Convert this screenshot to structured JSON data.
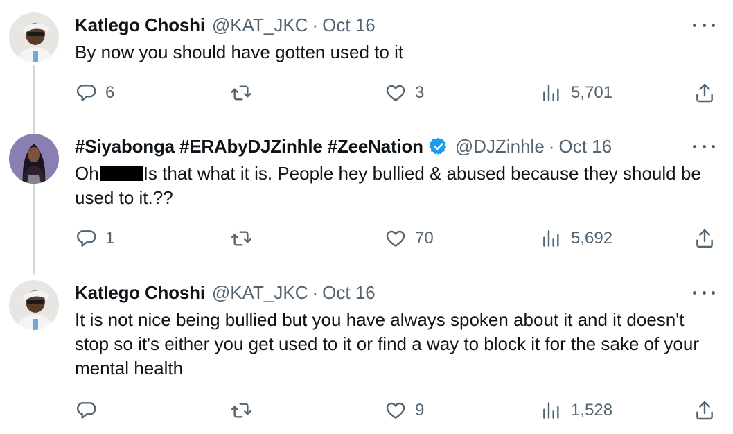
{
  "tweets": [
    {
      "name": "Katlego Choshi",
      "handle": "@KAT_JKC",
      "separator": "·",
      "date": "Oct 16",
      "verified": false,
      "text": "By now you should have gotten used to it",
      "replies": "6",
      "retweets": "",
      "likes": "3",
      "views": "5,701"
    },
    {
      "name": "#Siyabonga #ERAbyDJZinhle #ZeeNation",
      "handle": "@DJZinhle",
      "separator": "·",
      "date": "Oct 16",
      "verified": true,
      "text_before_redaction": "Oh",
      "text_after_redaction": "Is that what it is. People hey bullied & abused because they should be used to it.??",
      "replies": "1",
      "retweets": "",
      "likes": "70",
      "views": "5,692"
    },
    {
      "name": "Katlego Choshi",
      "handle": "@KAT_JKC",
      "separator": "·",
      "date": "Oct 16",
      "verified": false,
      "text": "It is not nice being bullied but you have always spoken about it and it doesn't stop so it's either you get used to it or find a way to block it for the sake of your mental health",
      "replies": "",
      "retweets": "",
      "likes": "9",
      "views": "1,528"
    }
  ],
  "icons": [
    "reply-icon",
    "retweet-icon",
    "like-icon",
    "views-icon",
    "share-icon",
    "more-icon",
    "verified-badge-icon"
  ],
  "colors": {
    "text": "#0f1419",
    "secondary": "#536471",
    "thread_line": "#cfd9de",
    "verified": "#1d9bf0"
  }
}
